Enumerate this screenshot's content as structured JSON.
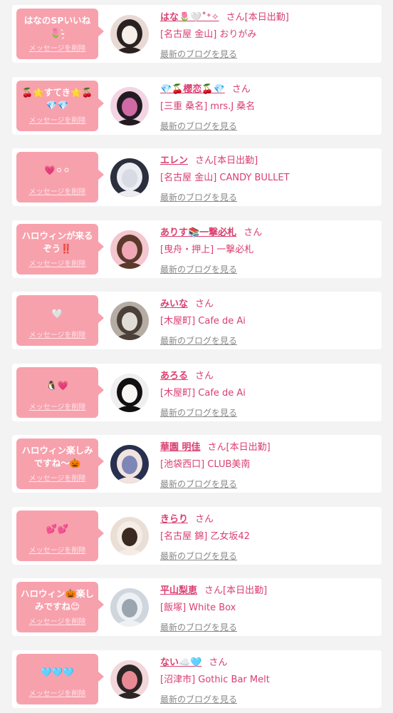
{
  "blog_link_label": "最新のブログを見る",
  "delete_label": "メッセージを削除",
  "san_label": "さん",
  "colors": {
    "accent": "#d93f70",
    "bubble": "#f7a1ad",
    "link_gray": "#888888",
    "background": "#f3f3f3"
  },
  "messages": [
    {
      "bubble_text": "はなのSPいいね\n🌷‐̗̀",
      "name": "はな🌷🤍˚⁺✧",
      "status": "[本日出勤]",
      "shop": "[名古屋 金山] おりがみ",
      "avatar_icon": "avatar-photo-icon",
      "avatar_colors": [
        "#e9d9d4",
        "#f6eee9",
        "#2a2220"
      ]
    },
    {
      "bubble_text": "🍒🌟すてき🌟🍒\n💎💎",
      "name": "💎🍒櫻恋🍒💎",
      "status": "",
      "shop": "[三重 桑名] mrs.J 桑名",
      "avatar_icon": "avatar-photo-icon",
      "avatar_colors": [
        "#f2d4e4",
        "#cf6aa5",
        "#221c22"
      ]
    },
    {
      "bubble_text": "💗⚪⚪",
      "name": "エレン",
      "status": "[本日出勤]",
      "shop": "[名古屋 金山] CANDY BULLET",
      "avatar_icon": "avatar-photo-icon",
      "avatar_colors": [
        "#2b2f3e",
        "#d8dbe4",
        "#ecedf2"
      ]
    },
    {
      "bubble_text": "ハロウィンが来る\nぞう‼️",
      "name": "ありす📚一撃必札",
      "status": "",
      "shop": "[曳舟・押上] 一撃必札",
      "avatar_icon": "avatar-photo-icon",
      "avatar_colors": [
        "#f4c6cf",
        "#f0a8b7",
        "#5a3a2a"
      ]
    },
    {
      "bubble_text": "🤍",
      "name": "みいな",
      "status": "",
      "shop": "[木屋町] Cafe de Ai",
      "avatar_icon": "avatar-photo-icon",
      "avatar_colors": [
        "#b5aca4",
        "#e2dcd6",
        "#4b413a"
      ]
    },
    {
      "bubble_text": "🐧💗",
      "name": "あろる",
      "status": "",
      "shop": "[木屋町] Cafe de Ai",
      "avatar_icon": "avatar-photo-icon",
      "avatar_colors": [
        "#f0eef0",
        "#f8f5f5",
        "#111111"
      ]
    },
    {
      "bubble_text": "ハロウィン楽しみ\nですね〜🎃",
      "name": "華園 明佳",
      "status": "[本日出勤]",
      "shop": "[池袋西口] CLUB美南",
      "avatar_icon": "avatar-photo-icon",
      "avatar_colors": [
        "#27304e",
        "#7d86b7",
        "#f1e3df"
      ]
    },
    {
      "bubble_text": "💕💕",
      "name": "きらり",
      "status": "",
      "shop": "[名古屋 錦] 乙女坂42",
      "avatar_icon": "avatar-photo-icon",
      "avatar_colors": [
        "#e9dfd6",
        "#3a2a22",
        "#f6ece6"
      ]
    },
    {
      "bubble_text": "ハロウィン🎃楽し\nみですね😊",
      "name": "平山梨恵",
      "status": "[本日出勤]",
      "shop": "[飯塚] White Box",
      "avatar_icon": "avatar-photo-icon",
      "avatar_colors": [
        "#cfd6dd",
        "#9aa5b0",
        "#eef1f4"
      ]
    },
    {
      "bubble_text": "🩵🩵🩵",
      "name": "ない☁️🩵",
      "status": "",
      "shop": "[沼津市] Gothic Bar Melt",
      "avatar_icon": "avatar-photo-icon",
      "avatar_colors": [
        "#f1d7da",
        "#e88a94",
        "#2b2526"
      ]
    }
  ]
}
